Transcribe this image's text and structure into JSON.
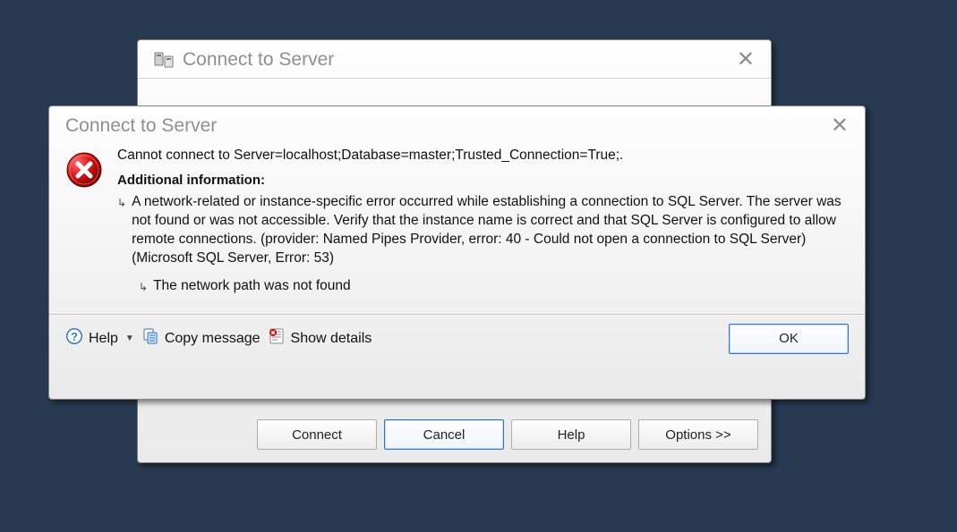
{
  "back_dialog": {
    "title": "Connect to Server",
    "buttons": {
      "connect": "Connect",
      "cancel": "Cancel",
      "help": "Help",
      "options": "Options >>"
    }
  },
  "error_dialog": {
    "title": "Connect to Server",
    "message": "Cannot connect to Server=localhost;Database=master;Trusted_Connection=True;.",
    "additional_heading": "Additional information:",
    "details": [
      "A network-related or instance-specific error occurred while establishing a connection to SQL Server. The server was not found or was not accessible. Verify that the instance name is correct and that SQL Server is configured to allow remote connections. (provider: Named Pipes Provider, error: 40 - Could not open a connection to SQL Server) (Microsoft SQL Server, Error: 53)",
      "The network path was not found"
    ],
    "actions": {
      "help": "Help",
      "copy_message": "Copy message",
      "show_details": "Show details",
      "ok": "OK"
    }
  }
}
